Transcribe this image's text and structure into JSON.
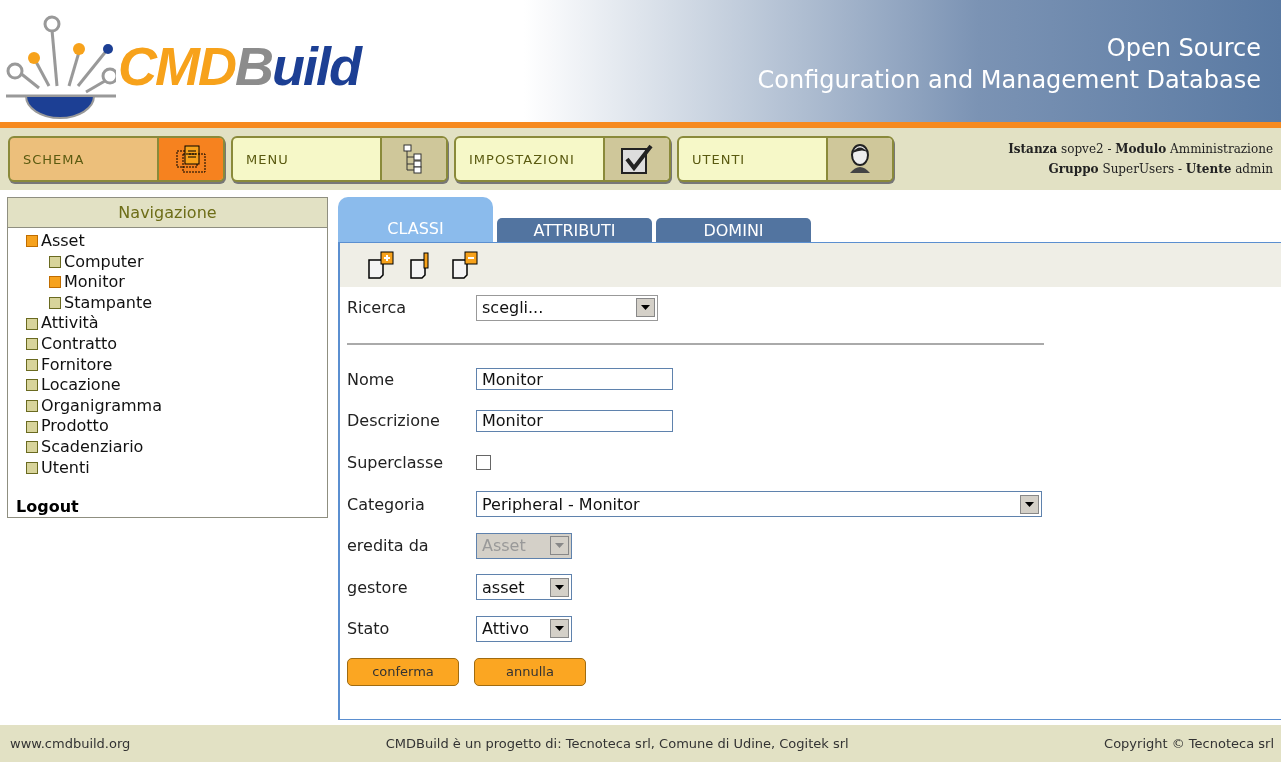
{
  "header": {
    "logo": [
      {
        "text": "CMD",
        "color": "#f7a21b"
      },
      {
        "text": "B",
        "color": "#8c8c8c"
      },
      {
        "text": "uild",
        "color": "#1c3f94"
      }
    ],
    "tagline": [
      "Open Source",
      "Configuration and Management Database"
    ]
  },
  "modules": [
    {
      "label": "SCHEMA",
      "selected": true,
      "kind": "schema"
    },
    {
      "label": "MENU",
      "selected": false,
      "kind": "tree"
    },
    {
      "label": "IMPOSTAZIONI",
      "selected": false,
      "kind": "check"
    },
    {
      "label": "UTENTI",
      "selected": false,
      "kind": "user"
    }
  ],
  "session": [
    "**Istanza** sopve2  -  **Modulo** Amministrazione",
    "**Gruppo** SuperUsers  -  **Utente** admin"
  ],
  "navigation": {
    "title": "Navigazione",
    "items": [
      {
        "label": "Asset",
        "selected": true,
        "children": [
          {
            "label": "Computer",
            "selected": false
          },
          {
            "label": "Monitor",
            "selected": true
          },
          {
            "label": "Stampante",
            "selected": false
          }
        ]
      },
      {
        "label": "Attività",
        "selected": false
      },
      {
        "label": "Contratto",
        "selected": false
      },
      {
        "label": "Fornitore",
        "selected": false
      },
      {
        "label": "Locazione",
        "selected": false
      },
      {
        "label": "Organigramma",
        "selected": false
      },
      {
        "label": "Prodotto",
        "selected": false
      },
      {
        "label": "Scadenziario",
        "selected": false
      },
      {
        "label": "Utenti",
        "selected": false
      }
    ],
    "logout": "Logout"
  },
  "tabs": [
    {
      "label": "CLASSI",
      "selected": true
    },
    {
      "label": "ATTRIBUTI",
      "selected": false
    },
    {
      "label": "DOMINI",
      "selected": false
    }
  ],
  "toolbar": [
    {
      "kind": "add"
    },
    {
      "kind": "edit"
    },
    {
      "kind": "remove"
    }
  ],
  "search": {
    "label": "Ricerca",
    "value": "scegli..."
  },
  "form": [
    {
      "label": "Nome",
      "kind": "text",
      "value": "Monitor"
    },
    {
      "label": "Descrizione",
      "kind": "text",
      "value": "Monitor"
    },
    {
      "label": "Superclasse",
      "kind": "checkbox",
      "checked": false
    },
    {
      "label": "Categoria",
      "kind": "combo",
      "value": "Peripheral - Monitor",
      "disabled": false
    },
    {
      "label": "eredita da",
      "kind": "select",
      "value": "Asset",
      "disabled": true
    },
    {
      "label": "gestore",
      "kind": "select",
      "value": "asset",
      "disabled": false
    },
    {
      "label": "Stato",
      "kind": "select",
      "value": "Attivo",
      "disabled": false
    }
  ],
  "buttons": [
    "conferma",
    "annulla"
  ],
  "footer": [
    "www.cmdbuild.org",
    "CMDBuild è un progetto di: Tecnoteca srl, Comune di Udine, Cogitek srl",
    "Copyright © Tecnoteca srl"
  ]
}
